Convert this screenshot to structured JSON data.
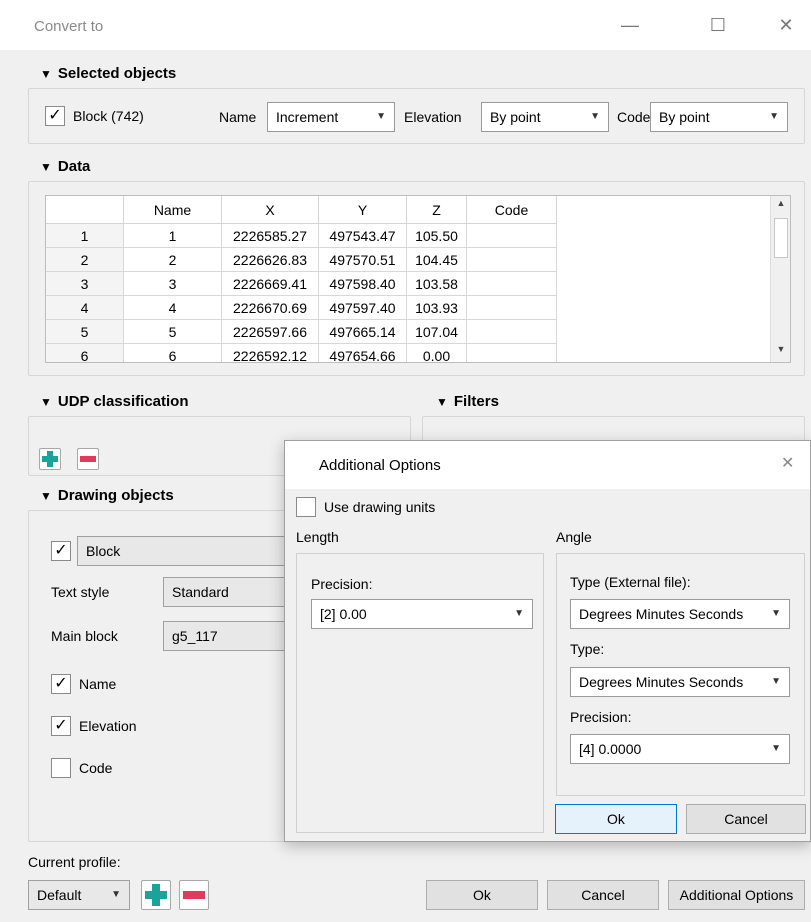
{
  "window": {
    "title": "Convert to",
    "minimize_glyph": "—",
    "maximize_glyph": "☐",
    "close_glyph": "✕"
  },
  "selected": {
    "header": "Selected objects",
    "block_label": "Block (742)",
    "block_checked": true,
    "name_label": "Name",
    "name_value": "Increment",
    "elevation_label": "Elevation",
    "elevation_value": "By point",
    "code_label": "Code",
    "code_value": "By point"
  },
  "data": {
    "header": "Data",
    "columns": [
      "Name",
      "X",
      "Y",
      "Z",
      "Code"
    ],
    "rows": [
      {
        "index": "1",
        "name": "1",
        "x": "2226585.27",
        "y": "497543.47",
        "z": "105.50",
        "code": ""
      },
      {
        "index": "2",
        "name": "2",
        "x": "2226626.83",
        "y": "497570.51",
        "z": "104.45",
        "code": ""
      },
      {
        "index": "3",
        "name": "3",
        "x": "2226669.41",
        "y": "497598.40",
        "z": "103.58",
        "code": ""
      },
      {
        "index": "4",
        "name": "4",
        "x": "2226670.69",
        "y": "497597.40",
        "z": "103.93",
        "code": ""
      },
      {
        "index": "5",
        "name": "5",
        "x": "2226597.66",
        "y": "497665.14",
        "z": "107.04",
        "code": ""
      },
      {
        "index": "6",
        "name": "6",
        "x": "2226592.12",
        "y": "497654.66",
        "z": "0.00",
        "code": ""
      }
    ]
  },
  "udp": {
    "header": "UDP classification"
  },
  "filters": {
    "header": "Filters"
  },
  "drawing": {
    "header": "Drawing objects",
    "block_checked": true,
    "block_value": "Block",
    "text_style_label": "Text style",
    "text_style_value": "Standard",
    "main_block_label": "Main block",
    "main_block_value": "g5_117",
    "name_label": "Name",
    "name_checked": true,
    "elevation_label": "Elevation",
    "elevation_checked": true,
    "code_label": "Code",
    "code_checked": false
  },
  "profile": {
    "label": "Current profile:",
    "value": "Default"
  },
  "footer": {
    "ok": "Ok",
    "cancel": "Cancel",
    "additional": "Additional Options"
  },
  "dialog": {
    "title": "Additional Options",
    "use_units_label": "Use drawing units",
    "use_units_checked": false,
    "length_label": "Length",
    "length_precision_label": "Precision:",
    "length_precision_value": "[2] 0.00",
    "angle_label": "Angle",
    "type_external_label": "Type (External file):",
    "type_external_value": "Degrees Minutes Seconds",
    "type_label": "Type:",
    "type_value": "Degrees Minutes Seconds",
    "angle_precision_label": "Precision:",
    "angle_precision_value": "[4] 0.0000",
    "ok": "Ok",
    "cancel": "Cancel",
    "close_glyph": "✕"
  },
  "symbols": {
    "check": "✓",
    "triangle": "▼",
    "arrow_down": "▼",
    "arrow_up": "▲"
  },
  "colors": {
    "plus_icon": "#1aa39a",
    "minus_icon": "#e03b5c",
    "accent": "#0078d7"
  }
}
